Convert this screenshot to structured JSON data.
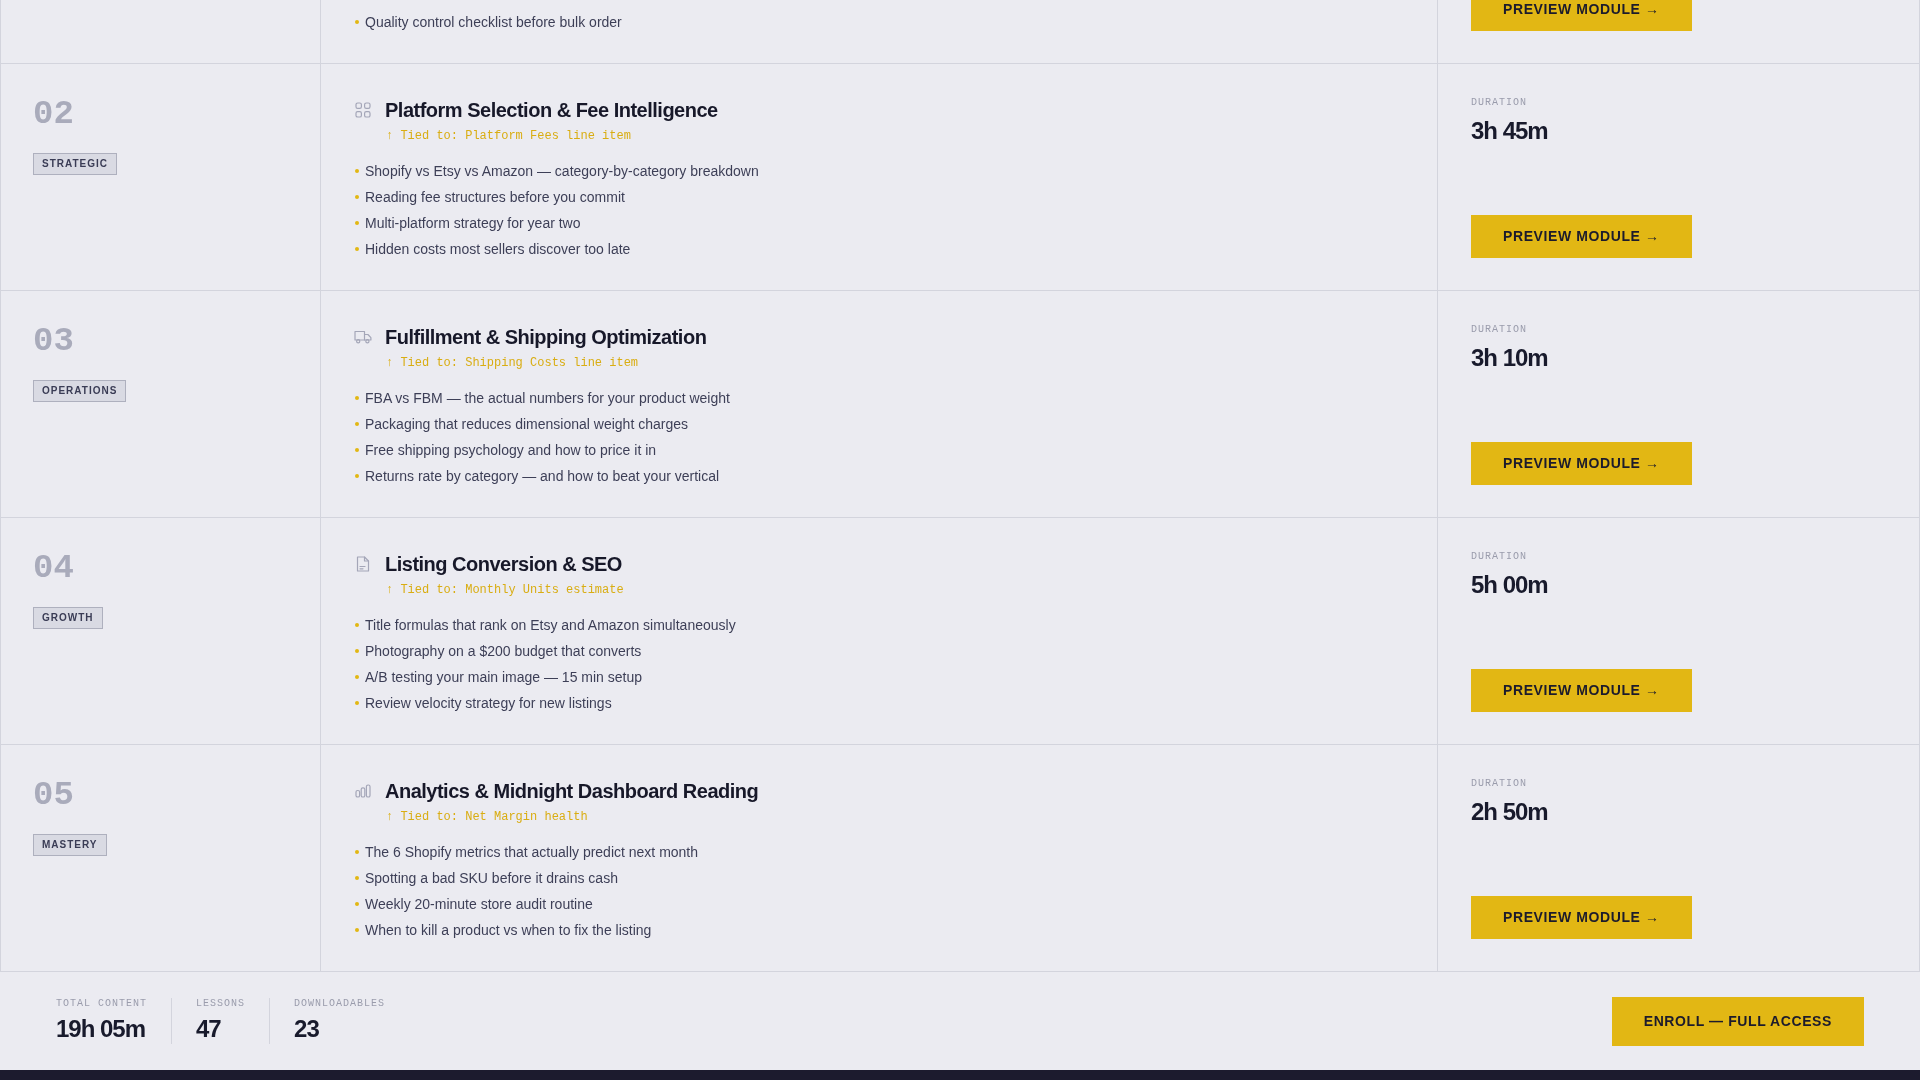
{
  "modules": [
    {
      "bullets": [
        "Quality control checklist before bulk order"
      ],
      "button": "PREVIEW MODULE →"
    },
    {
      "number": "02",
      "tag": "STRATEGIC",
      "title": "Platform Selection & Fee Intelligence",
      "tied_to": "↑ Tied to: Platform Fees line item",
      "bullets": [
        "Shopify vs Etsy vs Amazon — category-by-category breakdown",
        "Reading fee structures before you commit",
        "Multi-platform strategy for year two",
        "Hidden costs most sellers discover too late"
      ],
      "duration_label": "DURATION",
      "duration": "3h 45m",
      "button": "PREVIEW MODULE →"
    },
    {
      "number": "03",
      "tag": "OPERATIONS",
      "title": "Fulfillment & Shipping Optimization",
      "tied_to": "↑ Tied to: Shipping Costs line item",
      "bullets": [
        "FBA vs FBM — the actual numbers for your product weight",
        "Packaging that reduces dimensional weight charges",
        "Free shipping psychology and how to price it in",
        "Returns rate by category — and how to beat your vertical"
      ],
      "duration_label": "DURATION",
      "duration": "3h 10m",
      "button": "PREVIEW MODULE →"
    },
    {
      "number": "04",
      "tag": "GROWTH",
      "title": "Listing Conversion & SEO",
      "tied_to": "↑ Tied to: Monthly Units estimate",
      "bullets": [
        "Title formulas that rank on Etsy and Amazon simultaneously",
        "Photography on a $200 budget that converts",
        "A/B testing your main image — 15 min setup",
        "Review velocity strategy for new listings"
      ],
      "duration_label": "DURATION",
      "duration": "5h 00m",
      "button": "PREVIEW MODULE →"
    },
    {
      "number": "05",
      "tag": "MASTERY",
      "title": "Analytics & Midnight Dashboard Reading",
      "tied_to": "↑ Tied to: Net Margin health",
      "bullets": [
        "The 6 Shopify metrics that actually predict next month",
        "Spotting a bad SKU before it drains cash",
        "Weekly 20-minute store audit routine",
        "When to kill a product vs when to fix the listing"
      ],
      "duration_label": "DURATION",
      "duration": "2h 50m",
      "button": "PREVIEW MODULE →"
    }
  ],
  "footer": {
    "stats": [
      {
        "label": "TOTAL CONTENT",
        "value": "19h 05m"
      },
      {
        "label": "LESSONS",
        "value": "47"
      },
      {
        "label": "DOWNLOADABLES",
        "value": "23"
      }
    ],
    "button": "ENROLL — FULL ACCESS"
  }
}
